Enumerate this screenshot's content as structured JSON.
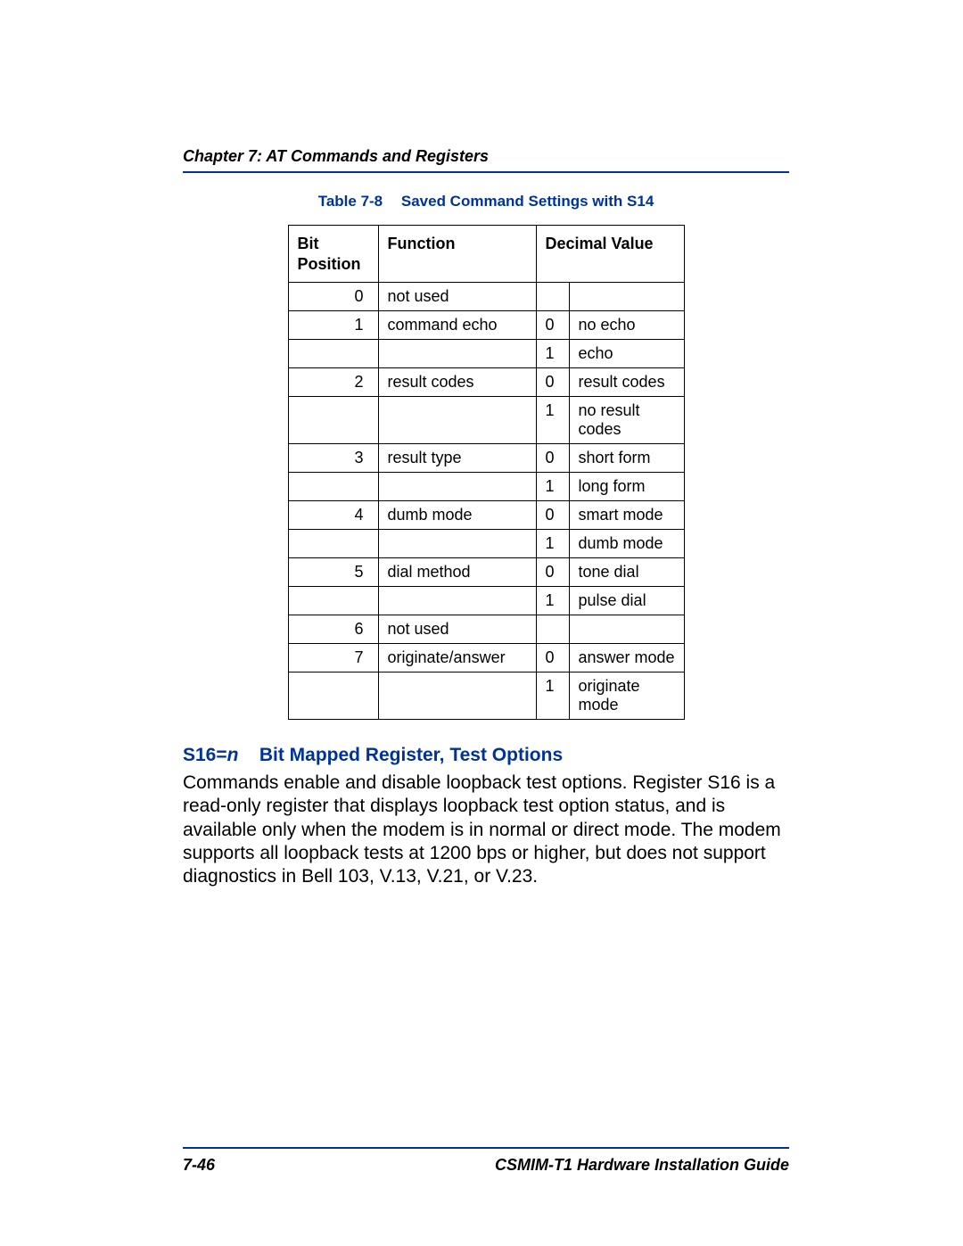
{
  "header": {
    "running_head": "Chapter 7: AT Commands and Registers"
  },
  "table": {
    "caption_label": "Table 7-8",
    "caption_title": "Saved Command Settings with S14",
    "headers": {
      "bit": "Bit Position",
      "func": "Function",
      "dec": "Decimal Value"
    },
    "rows": [
      {
        "bit": "0",
        "func": "not used",
        "dec": "",
        "desc": ""
      },
      {
        "bit": "1",
        "func": "command echo",
        "dec": "0",
        "desc": "no echo"
      },
      {
        "bit": "",
        "func": "",
        "dec": "1",
        "desc": "echo"
      },
      {
        "bit": "2",
        "func": "result codes",
        "dec": "0",
        "desc": "result codes"
      },
      {
        "bit": "",
        "func": "",
        "dec": "1",
        "desc": "no result codes"
      },
      {
        "bit": "3",
        "func": "result type",
        "dec": "0",
        "desc": "short form"
      },
      {
        "bit": "",
        "func": "",
        "dec": "1",
        "desc": "long form"
      },
      {
        "bit": "4",
        "func": "dumb mode",
        "dec": "0",
        "desc": "smart mode"
      },
      {
        "bit": "",
        "func": "",
        "dec": "1",
        "desc": "dumb mode"
      },
      {
        "bit": "5",
        "func": "dial method",
        "dec": "0",
        "desc": "tone dial"
      },
      {
        "bit": "",
        "func": "",
        "dec": "1",
        "desc": "pulse dial"
      },
      {
        "bit": "6",
        "func": "not used",
        "dec": "",
        "desc": ""
      },
      {
        "bit": "7",
        "func": "originate/answer",
        "dec": "0",
        "desc": "answer mode"
      },
      {
        "bit": "",
        "func": "",
        "dec": "1",
        "desc": "originate mode"
      }
    ]
  },
  "section": {
    "title_prefix": "S16=",
    "title_var": "n",
    "title_rest": "Bit Mapped Register, Test Options",
    "body": "Commands enable and disable loopback test options. Register S16 is a read-only register that displays loopback test option status, and is available only when the modem is in normal or direct mode. The modem supports all loopback tests at 1200 bps or higher, but does not support diagnostics in Bell 103, V.13, V.21, or V.23."
  },
  "footer": {
    "page": "7-46",
    "doc": "CSMIM-T1 Hardware Installation Guide"
  }
}
